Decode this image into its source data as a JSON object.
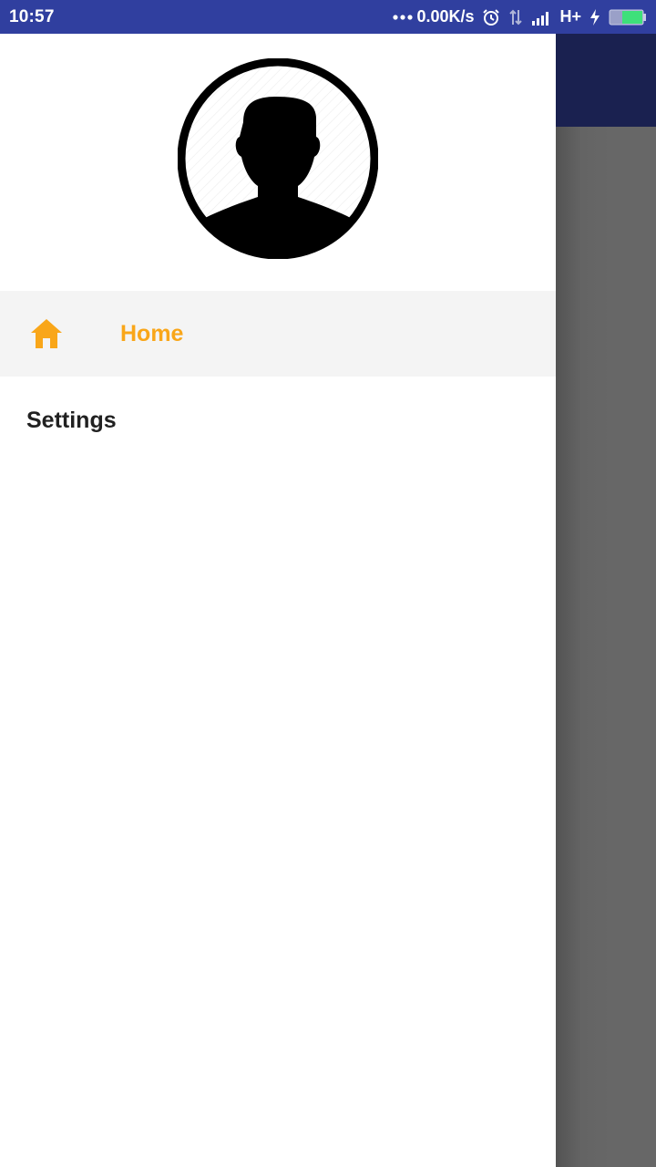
{
  "status_bar": {
    "time": "10:57",
    "network_speed": "0.00K/s",
    "network_type": "H+",
    "icons": [
      "more-dots-icon",
      "alarm-icon",
      "data-transfer-icon",
      "signal-icon",
      "charging-icon",
      "battery-icon"
    ]
  },
  "drawer": {
    "avatar_icon": "user-silhouette-icon",
    "items": [
      {
        "label": "Home",
        "icon": "home-icon",
        "selected": true,
        "color": "#f9a619"
      },
      {
        "label": "Settings",
        "selected": false,
        "color": "#212121"
      }
    ]
  },
  "colors": {
    "status_bar": "#303f9f",
    "app_bar": "#1a2150",
    "accent": "#f9a619",
    "scrim": "#676767",
    "selected_item_bg": "#f4f4f4"
  }
}
